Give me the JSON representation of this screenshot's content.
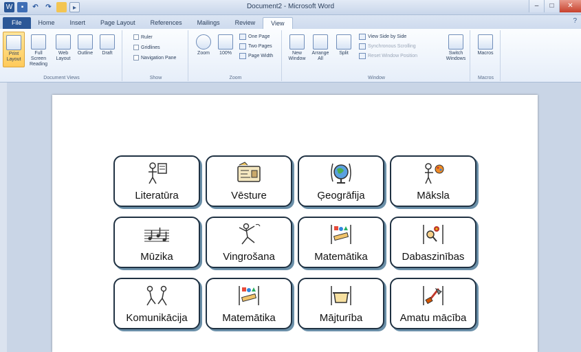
{
  "window": {
    "title": "Document2 - Microsoft Word",
    "controls": [
      "–",
      "□",
      "✕"
    ]
  },
  "qat": {
    "icons": [
      "word-logo",
      "save-icon",
      "undo-icon",
      "redo-icon",
      "open-icon",
      "pdf-icon"
    ]
  },
  "tabs": [
    "File",
    "Home",
    "Insert",
    "Page Layout",
    "References",
    "Mailings",
    "Review",
    "View"
  ],
  "active_tab": "View",
  "ribbon": {
    "document_views": {
      "label": "Document Views",
      "buttons": [
        "Print Layout",
        "Full Screen Reading",
        "Web Layout",
        "Outline",
        "Draft"
      ]
    },
    "show": {
      "label": "Show",
      "checks": [
        "Ruler",
        "Gridlines",
        "Navigation Pane"
      ]
    },
    "zoom": {
      "label": "Zoom",
      "buttons": [
        "Zoom",
        "100%"
      ],
      "small": [
        "One Page",
        "Two Pages",
        "Page Width"
      ]
    },
    "window": {
      "label": "Window",
      "buttons": [
        "New Window",
        "Arrange All",
        "Split"
      ],
      "small": [
        "View Side by Side",
        "Synchronous Scrolling",
        "Reset Window Position"
      ],
      "switch": "Switch Windows"
    },
    "macros": {
      "label": "Macros",
      "button": "Macros"
    }
  },
  "tiles": [
    {
      "label": "Literatūra",
      "icon": "reading-icon"
    },
    {
      "label": "Vēsture",
      "icon": "history-icon"
    },
    {
      "label": "Ģeogrāfija",
      "icon": "globe-icon"
    },
    {
      "label": "Māksla",
      "icon": "art-icon"
    },
    {
      "label": "Mūzika",
      "icon": "music-icon"
    },
    {
      "label": "Vingrošana",
      "icon": "gymnastics-icon"
    },
    {
      "label": "Matemātika",
      "icon": "math-icon"
    },
    {
      "label": "Dabaszinības",
      "icon": "science-icon"
    },
    {
      "label": "Komunikācija",
      "icon": "communication-icon"
    },
    {
      "label": "Matemātika",
      "icon": "math-icon"
    },
    {
      "label": "Mājturība",
      "icon": "home-economics-icon"
    },
    {
      "label": "Amatu mācība",
      "icon": "crafts-icon"
    }
  ]
}
